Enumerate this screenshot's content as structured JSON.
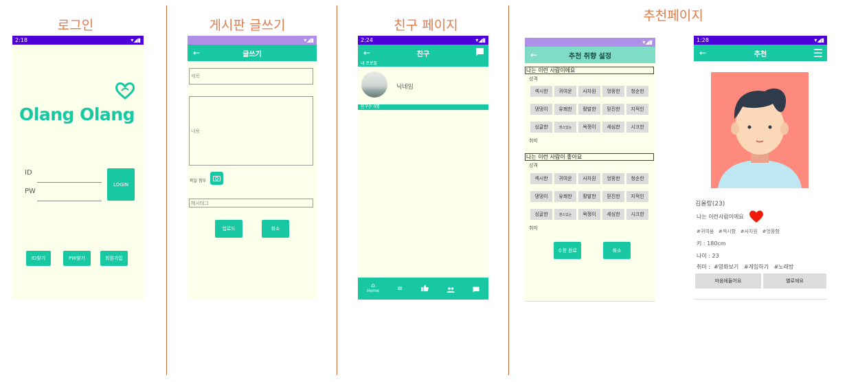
{
  "sections": {
    "login": "로그인",
    "write": "게시판 글쓰기",
    "friends": "친구 페이지",
    "recommend": "추천페이지"
  },
  "status": {
    "login_time": "2:18",
    "friends_time": "2:24",
    "recommend_time": "1:28"
  },
  "login": {
    "logo": "Olang Olang",
    "id_label": "ID",
    "pw_label": "PW",
    "login_button": "LOGIN",
    "find_id": "ID찾기",
    "find_pw": "PW찾기",
    "signup": "회원가입"
  },
  "write": {
    "title": "글쓰기",
    "subject_placeholder": "제목",
    "content_placeholder": "내용",
    "attach_label": "파일 첨부",
    "hashtag_placeholder": "해시태그",
    "upload": "업로드",
    "cancel": "취소"
  },
  "friends": {
    "title": "친구",
    "my_profile": "내 프로필",
    "nickname": "닉네임",
    "friend_count": "친구수 0명",
    "nav_home": "Home"
  },
  "pref": {
    "title": "추천 취향 설정",
    "i_am": "나는 이런 사람이에요",
    "i_like": "나는 이런 사람이 좋아요",
    "personality": "성격",
    "hobby": "취미",
    "chips": [
      "섹시한",
      "귀여운",
      "사차원",
      "엉뚱한",
      "청순한",
      "댕댕이",
      "유쾌한",
      "활발한",
      "믿진한",
      "지적인",
      "싱글한",
      "센스있는",
      "욕쟁이",
      "세심한",
      "시크한"
    ],
    "chips2": [
      "섹시한",
      "귀여운",
      "사차원",
      "엉뚱한",
      "청순한",
      "댕댕이",
      "유쾌한",
      "활발한",
      "믿진한",
      "지적인",
      "싱글한",
      "센스있는",
      "욕쟁이",
      "세심한",
      "시크한"
    ],
    "done": "수정 완료",
    "cancel": "취소"
  },
  "recommend": {
    "title": "추천",
    "name": "김올랑(23)",
    "intro": "나는 이런사람이에요",
    "tags": "#귀여움   #섹시함   #사차원   #엉뚱함",
    "height": "키 : 180cm",
    "age": "나이 : 23",
    "hobby": "취미 :  #영화보기   #게임하기   #노래방",
    "like": "마음에들어요",
    "dislike": "별로에요"
  },
  "colors": {
    "accent": "#17c8a2",
    "status_bar": "#4d00d8",
    "phone_bg": "#fcffe9",
    "section_title": "#e07b4a",
    "avatar_bg": "#fd8a7c"
  }
}
